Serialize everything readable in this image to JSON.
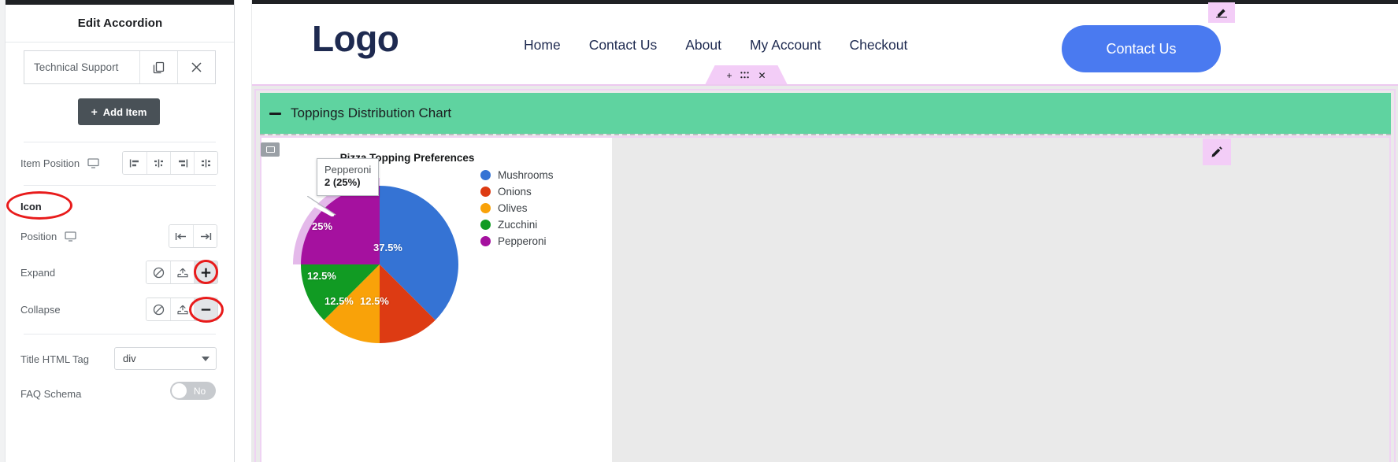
{
  "editor_panel": {
    "title": "Edit Accordion",
    "item": {
      "label": "Technical Support",
      "duplicate_icon": "copy-icon",
      "delete_icon": "close-icon"
    },
    "add_item_button": "Add Item",
    "add_item_plus": "+",
    "controls": [
      {
        "key": "item_position",
        "label": "Item Position",
        "device_icon": "desktop-icon",
        "options": [
          "align-left",
          "align-center",
          "align-right",
          "align-justify"
        ],
        "selected": -1
      },
      {
        "key": "icon_heading",
        "label": "Icon",
        "annotated": true
      },
      {
        "key": "position",
        "label": "Position",
        "device_icon": "desktop-icon",
        "options": [
          "align-start",
          "align-end"
        ],
        "selected": -1
      },
      {
        "key": "expand",
        "label": "Expand",
        "options": [
          "none",
          "upload-custom",
          "plus"
        ],
        "selected": 2,
        "annotated": true
      },
      {
        "key": "collapse",
        "label": "Collapse",
        "options": [
          "none",
          "upload-custom",
          "minus"
        ],
        "selected": 2,
        "annotated": true
      }
    ],
    "title_html_tag": {
      "label": "Title HTML Tag",
      "value": "div"
    },
    "faq_schema": {
      "label": "FAQ Schema",
      "value": "No"
    },
    "collapse_tab_icon": "chevron-left-icon"
  },
  "site_header": {
    "logo": "Logo",
    "nav": [
      "Home",
      "Contact Us",
      "About",
      "My Account",
      "Checkout"
    ],
    "cta_label": "Contact Us",
    "cta_color": "#4a7af0"
  },
  "section_tab": {
    "add_icon": "plus-icon",
    "drag_icon": "drag-handle-icon",
    "close_icon": "close-icon"
  },
  "accordion": {
    "item_title": "Toppings Distribution Chart",
    "state_icon": "minus-icon",
    "header_color": "#5fd3a0",
    "handle_icon": "widget-handle-icon",
    "edit_chip_icon": "pencil-icon"
  },
  "chart_data": {
    "type": "pie",
    "title": "Pizza Topping Preferences",
    "categories": [
      "Mushrooms",
      "Onions",
      "Olives",
      "Zucchini",
      "Pepperoni"
    ],
    "values": [
      3,
      1,
      1,
      1,
      2
    ],
    "percentages": [
      37.5,
      12.5,
      12.5,
      12.5,
      25
    ],
    "labels": [
      "37.5%",
      "12.5%",
      "12.5%",
      "12.5%",
      "25%"
    ],
    "colors": [
      "#3573d4",
      "#dd3b13",
      "#f9a209",
      "#119b23",
      "#a5119f"
    ],
    "legend_position": "right",
    "tooltip": {
      "name": "Pepperoni",
      "value": "2 (25%)",
      "highlight_slice": "Pepperoni",
      "highlight_color": "#e4b9ea"
    }
  }
}
